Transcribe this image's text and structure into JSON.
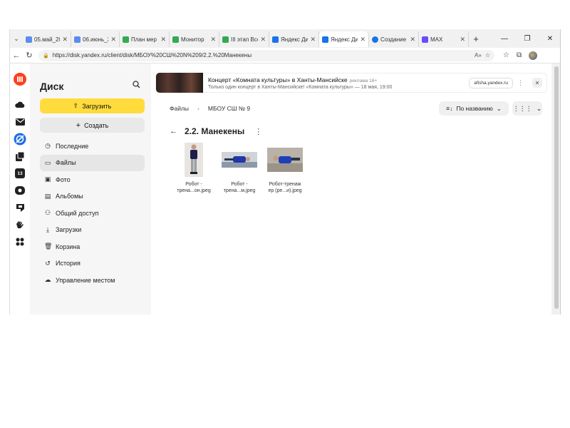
{
  "browser": {
    "tabs": [
      {
        "title": "05.май_20",
        "color": "#5b8def"
      },
      {
        "title": "06.июнь_2",
        "color": "#5b8def"
      },
      {
        "title": "План мер",
        "color": "#34a853"
      },
      {
        "title": "Монитор",
        "color": "#34a853"
      },
      {
        "title": "III этап Все",
        "color": "#34a853"
      },
      {
        "title": "Яндекс Ди",
        "color": "#1a73e8"
      },
      {
        "title": "Яндекс Ди",
        "color": "#1a73e8",
        "active": true
      },
      {
        "title": "Создание",
        "color": "#1a73e8"
      },
      {
        "title": "MAX",
        "color": "#6a4cff"
      }
    ],
    "url": "https://disk.yandex.ru/client/disk/МБОУ%20СШ%20N%209/2.2.%20Манекены"
  },
  "sidebar": {
    "brand": "Диск",
    "upload_label": "Загрузить",
    "create_label": "Создать",
    "items": [
      {
        "label": "Последние",
        "icon": "clock-icon"
      },
      {
        "label": "Файлы",
        "icon": "folder-icon",
        "active": true
      },
      {
        "label": "Фото",
        "icon": "photo-icon"
      },
      {
        "label": "Альбомы",
        "icon": "album-icon"
      },
      {
        "label": "Общий доступ",
        "icon": "people-icon"
      },
      {
        "label": "Загрузки",
        "icon": "download-icon"
      },
      {
        "label": "Корзина",
        "icon": "trash-icon"
      },
      {
        "label": "История",
        "icon": "history-icon"
      },
      {
        "label": "Управление местом",
        "icon": "cloud-icon"
      }
    ]
  },
  "ad": {
    "title": "Концерт «Комната культуры» в Ханты-Мансийске",
    "mark": "реклама 16+",
    "subtitle": "Только один концерт в Ханты-Мансийске! «Комната культуры» — 18 мая, 19:00",
    "link": "afisha.yandex.ru"
  },
  "breadcrumbs": [
    "Файлы",
    "МБОУ СШ № 9"
  ],
  "sort_label": "По названию",
  "folder_title": "2.2. Манекены",
  "files": [
    {
      "name_line1": "Робот -",
      "name_line2": "трена...он.jpeg"
    },
    {
      "name_line1": "Робот -",
      "name_line2": "трена...м.jpeg"
    },
    {
      "name_line1": "Робот-тренаж",
      "name_line2": "ер (ре...и).jpeg"
    }
  ],
  "icons": {
    "rail": [
      "yandex-logo-icon",
      "cloud-icon",
      "mail-icon",
      "browser-icon",
      "docs-icon",
      "calendar-icon",
      "telemost-icon",
      "messenger-icon",
      "hand-icon",
      "apps-grid-icon"
    ],
    "rail_calendar_day": "13"
  },
  "colors": {
    "upload": "#ffdc3c",
    "sidebar_bg": "#f6f6f6",
    "brand_orange": "#fc3f1d"
  }
}
